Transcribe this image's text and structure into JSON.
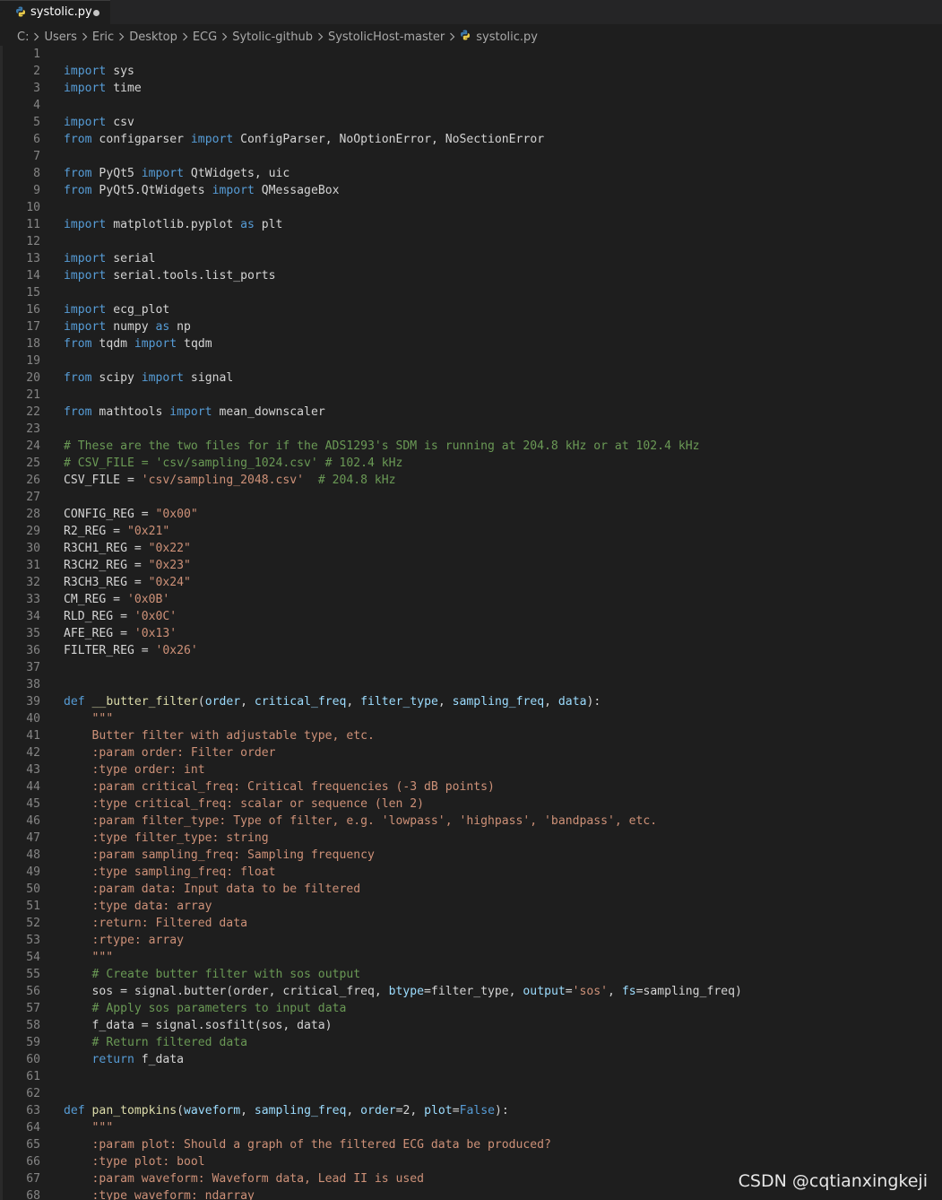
{
  "tab": {
    "icon": "python-file-icon",
    "label": "systolic.py",
    "dirty": true,
    "dirty_color": "#c5c5c5"
  },
  "breadcrumb": [
    {
      "label": "C:"
    },
    {
      "label": "Users"
    },
    {
      "label": "Eric"
    },
    {
      "label": "Desktop"
    },
    {
      "label": "ECG"
    },
    {
      "label": "Sytolic-github"
    },
    {
      "label": "SystolicHost-master"
    },
    {
      "label": "systolic.py",
      "icon": "python-file-icon"
    }
  ],
  "colors": {
    "background": "#1e1e1e",
    "keyword": "#569cd6",
    "import_keyword": "#c586c0",
    "string": "#ce9178",
    "comment": "#6a9955",
    "function": "#dcdcaa",
    "parameter": "#9cdcfe",
    "plain": "#d4d4d4",
    "line_number": "#858585"
  },
  "code": {
    "lines": [
      {
        "n": "1",
        "tokens": []
      },
      {
        "n": "2",
        "tokens": [
          [
            "kw",
            "import"
          ],
          [
            "pl",
            " sys"
          ]
        ]
      },
      {
        "n": "3",
        "tokens": [
          [
            "kw",
            "import"
          ],
          [
            "pl",
            " time"
          ]
        ]
      },
      {
        "n": "4",
        "tokens": []
      },
      {
        "n": "5",
        "tokens": [
          [
            "kw",
            "import"
          ],
          [
            "pl",
            " csv"
          ]
        ]
      },
      {
        "n": "6",
        "tokens": [
          [
            "kw",
            "from"
          ],
          [
            "pl",
            " configparser "
          ],
          [
            "kw",
            "import"
          ],
          [
            "pl",
            " ConfigParser, NoOptionError, NoSectionError"
          ]
        ]
      },
      {
        "n": "7",
        "tokens": []
      },
      {
        "n": "8",
        "tokens": [
          [
            "kw",
            "from"
          ],
          [
            "pl",
            " PyQt5 "
          ],
          [
            "kw",
            "import"
          ],
          [
            "pl",
            " QtWidgets, uic"
          ]
        ]
      },
      {
        "n": "9",
        "tokens": [
          [
            "kw",
            "from"
          ],
          [
            "pl",
            " PyQt5.QtWidgets "
          ],
          [
            "kw",
            "import"
          ],
          [
            "pl",
            " QMessageBox"
          ]
        ]
      },
      {
        "n": "10",
        "tokens": []
      },
      {
        "n": "11",
        "tokens": [
          [
            "kw",
            "import"
          ],
          [
            "pl",
            " matplotlib.pyplot "
          ],
          [
            "kw",
            "as"
          ],
          [
            "pl",
            " plt"
          ]
        ]
      },
      {
        "n": "12",
        "tokens": []
      },
      {
        "n": "13",
        "tokens": [
          [
            "kw",
            "import"
          ],
          [
            "pl",
            " serial"
          ]
        ]
      },
      {
        "n": "14",
        "tokens": [
          [
            "kw",
            "import"
          ],
          [
            "pl",
            " serial.tools.list_ports"
          ]
        ]
      },
      {
        "n": "15",
        "tokens": []
      },
      {
        "n": "16",
        "tokens": [
          [
            "kw",
            "import"
          ],
          [
            "pl",
            " ecg_plot"
          ]
        ]
      },
      {
        "n": "17",
        "tokens": [
          [
            "kw",
            "import"
          ],
          [
            "pl",
            " numpy "
          ],
          [
            "kw",
            "as"
          ],
          [
            "pl",
            " np"
          ]
        ]
      },
      {
        "n": "18",
        "tokens": [
          [
            "kw",
            "from"
          ],
          [
            "pl",
            " tqdm "
          ],
          [
            "kw",
            "import"
          ],
          [
            "pl",
            " tqdm"
          ]
        ]
      },
      {
        "n": "19",
        "tokens": []
      },
      {
        "n": "20",
        "tokens": [
          [
            "kw",
            "from"
          ],
          [
            "pl",
            " scipy "
          ],
          [
            "kw",
            "import"
          ],
          [
            "pl",
            " signal"
          ]
        ]
      },
      {
        "n": "21",
        "tokens": []
      },
      {
        "n": "22",
        "tokens": [
          [
            "kw",
            "from"
          ],
          [
            "pl",
            " mathtools "
          ],
          [
            "kw",
            "import"
          ],
          [
            "pl",
            " mean_downscaler"
          ]
        ]
      },
      {
        "n": "23",
        "tokens": []
      },
      {
        "n": "24",
        "tokens": [
          [
            "com",
            "# These are the two files for if the ADS1293's SDM is running at 204.8 kHz or at 102.4 kHz"
          ]
        ]
      },
      {
        "n": "25",
        "tokens": [
          [
            "com",
            "# CSV_FILE = 'csv/sampling_1024.csv' # 102.4 kHz"
          ]
        ]
      },
      {
        "n": "26",
        "tokens": [
          [
            "pl",
            "CSV_FILE = "
          ],
          [
            "str",
            "'csv/sampling_2048.csv'"
          ],
          [
            "pl",
            "  "
          ],
          [
            "com",
            "# 204.8 kHz"
          ]
        ]
      },
      {
        "n": "27",
        "tokens": []
      },
      {
        "n": "28",
        "tokens": [
          [
            "pl",
            "CONFIG_REG = "
          ],
          [
            "str",
            "\"0x00\""
          ]
        ]
      },
      {
        "n": "29",
        "tokens": [
          [
            "pl",
            "R2_REG = "
          ],
          [
            "str",
            "\"0x21\""
          ]
        ]
      },
      {
        "n": "30",
        "tokens": [
          [
            "pl",
            "R3CH1_REG = "
          ],
          [
            "str",
            "\"0x22\""
          ]
        ]
      },
      {
        "n": "31",
        "tokens": [
          [
            "pl",
            "R3CH2_REG = "
          ],
          [
            "str",
            "\"0x23\""
          ]
        ]
      },
      {
        "n": "32",
        "tokens": [
          [
            "pl",
            "R3CH3_REG = "
          ],
          [
            "str",
            "\"0x24\""
          ]
        ]
      },
      {
        "n": "33",
        "tokens": [
          [
            "pl",
            "CM_REG = "
          ],
          [
            "str",
            "'0x0B'"
          ]
        ]
      },
      {
        "n": "34",
        "tokens": [
          [
            "pl",
            "RLD_REG = "
          ],
          [
            "str",
            "'0x0C'"
          ]
        ]
      },
      {
        "n": "35",
        "tokens": [
          [
            "pl",
            "AFE_REG = "
          ],
          [
            "str",
            "'0x13'"
          ]
        ]
      },
      {
        "n": "36",
        "tokens": [
          [
            "pl",
            "FILTER_REG = "
          ],
          [
            "str",
            "'0x26'"
          ]
        ]
      },
      {
        "n": "37",
        "tokens": []
      },
      {
        "n": "38",
        "tokens": []
      },
      {
        "n": "39",
        "tokens": [
          [
            "kw",
            "def"
          ],
          [
            "pl",
            " "
          ],
          [
            "fn",
            "__butter_filter"
          ],
          [
            "pl",
            "("
          ],
          [
            "param",
            "order"
          ],
          [
            "pl",
            ", "
          ],
          [
            "param",
            "critical_freq"
          ],
          [
            "pl",
            ", "
          ],
          [
            "param",
            "filter_type"
          ],
          [
            "pl",
            ", "
          ],
          [
            "param",
            "sampling_freq"
          ],
          [
            "pl",
            ", "
          ],
          [
            "param",
            "data"
          ],
          [
            "pl",
            "):"
          ]
        ]
      },
      {
        "n": "40",
        "tokens": [
          [
            "pl",
            "    "
          ],
          [
            "str",
            "\"\"\""
          ]
        ]
      },
      {
        "n": "41",
        "tokens": [
          [
            "str",
            "    Butter filter with adjustable type, etc."
          ]
        ]
      },
      {
        "n": "42",
        "tokens": [
          [
            "str",
            "    :param order: Filter order"
          ]
        ]
      },
      {
        "n": "43",
        "tokens": [
          [
            "str",
            "    :type order: int"
          ]
        ]
      },
      {
        "n": "44",
        "tokens": [
          [
            "str",
            "    :param critical_freq: Critical frequencies (-3 dB points)"
          ]
        ]
      },
      {
        "n": "45",
        "tokens": [
          [
            "str",
            "    :type critical_freq: scalar or sequence (len 2)"
          ]
        ]
      },
      {
        "n": "46",
        "tokens": [
          [
            "str",
            "    :param filter_type: Type of filter, e.g. 'lowpass', 'highpass', 'bandpass', etc."
          ]
        ]
      },
      {
        "n": "47",
        "tokens": [
          [
            "str",
            "    :type filter_type: string"
          ]
        ]
      },
      {
        "n": "48",
        "tokens": [
          [
            "str",
            "    :param sampling_freq: Sampling frequency"
          ]
        ]
      },
      {
        "n": "49",
        "tokens": [
          [
            "str",
            "    :type sampling_freq: float"
          ]
        ]
      },
      {
        "n": "50",
        "tokens": [
          [
            "str",
            "    :param data: Input data to be filtered"
          ]
        ]
      },
      {
        "n": "51",
        "tokens": [
          [
            "str",
            "    :type data: array"
          ]
        ]
      },
      {
        "n": "52",
        "tokens": [
          [
            "str",
            "    :return: Filtered data"
          ]
        ]
      },
      {
        "n": "53",
        "tokens": [
          [
            "str",
            "    :rtype: array"
          ]
        ]
      },
      {
        "n": "54",
        "tokens": [
          [
            "str",
            "    \"\"\""
          ]
        ]
      },
      {
        "n": "55",
        "tokens": [
          [
            "pl",
            "    "
          ],
          [
            "com",
            "# Create butter filter with sos output"
          ]
        ]
      },
      {
        "n": "56",
        "tokens": [
          [
            "pl",
            "    sos = signal.butter(order, critical_freq, "
          ],
          [
            "param",
            "btype"
          ],
          [
            "pl",
            "=filter_type, "
          ],
          [
            "param",
            "output"
          ],
          [
            "pl",
            "="
          ],
          [
            "str",
            "'sos'"
          ],
          [
            "pl",
            ", "
          ],
          [
            "param",
            "fs"
          ],
          [
            "pl",
            "=sampling_freq)"
          ]
        ]
      },
      {
        "n": "57",
        "tokens": [
          [
            "pl",
            "    "
          ],
          [
            "com",
            "# Apply sos parameters to input data"
          ]
        ]
      },
      {
        "n": "58",
        "tokens": [
          [
            "pl",
            "    f_data = signal.sosfilt(sos, data)"
          ]
        ]
      },
      {
        "n": "59",
        "tokens": [
          [
            "pl",
            "    "
          ],
          [
            "com",
            "# Return filtered data"
          ]
        ]
      },
      {
        "n": "60",
        "tokens": [
          [
            "pl",
            "    "
          ],
          [
            "kw",
            "return"
          ],
          [
            "pl",
            " f_data"
          ]
        ]
      },
      {
        "n": "61",
        "tokens": []
      },
      {
        "n": "62",
        "tokens": []
      },
      {
        "n": "63",
        "tokens": [
          [
            "kw",
            "def"
          ],
          [
            "pl",
            " "
          ],
          [
            "fn",
            "pan_tompkins"
          ],
          [
            "pl",
            "("
          ],
          [
            "param",
            "waveform"
          ],
          [
            "pl",
            ", "
          ],
          [
            "param",
            "sampling_freq"
          ],
          [
            "pl",
            ", "
          ],
          [
            "param",
            "order"
          ],
          [
            "pl",
            "=2, "
          ],
          [
            "param",
            "plot"
          ],
          [
            "pl",
            "="
          ],
          [
            "kw",
            "False"
          ],
          [
            "pl",
            "):"
          ]
        ]
      },
      {
        "n": "64",
        "tokens": [
          [
            "pl",
            "    "
          ],
          [
            "str",
            "\"\"\""
          ]
        ]
      },
      {
        "n": "65",
        "tokens": [
          [
            "str",
            "    :param plot: Should a graph of the filtered ECG data be produced?"
          ]
        ]
      },
      {
        "n": "66",
        "tokens": [
          [
            "str",
            "    :type plot: bool"
          ]
        ]
      },
      {
        "n": "67",
        "tokens": [
          [
            "str",
            "    :param waveform: Waveform data, Lead II is used"
          ]
        ]
      },
      {
        "n": "68",
        "tokens": [
          [
            "str",
            "    :type waveform: ndarray"
          ]
        ]
      }
    ]
  },
  "watermark": {
    "text": "CSDN @cqtianxingkeji"
  }
}
